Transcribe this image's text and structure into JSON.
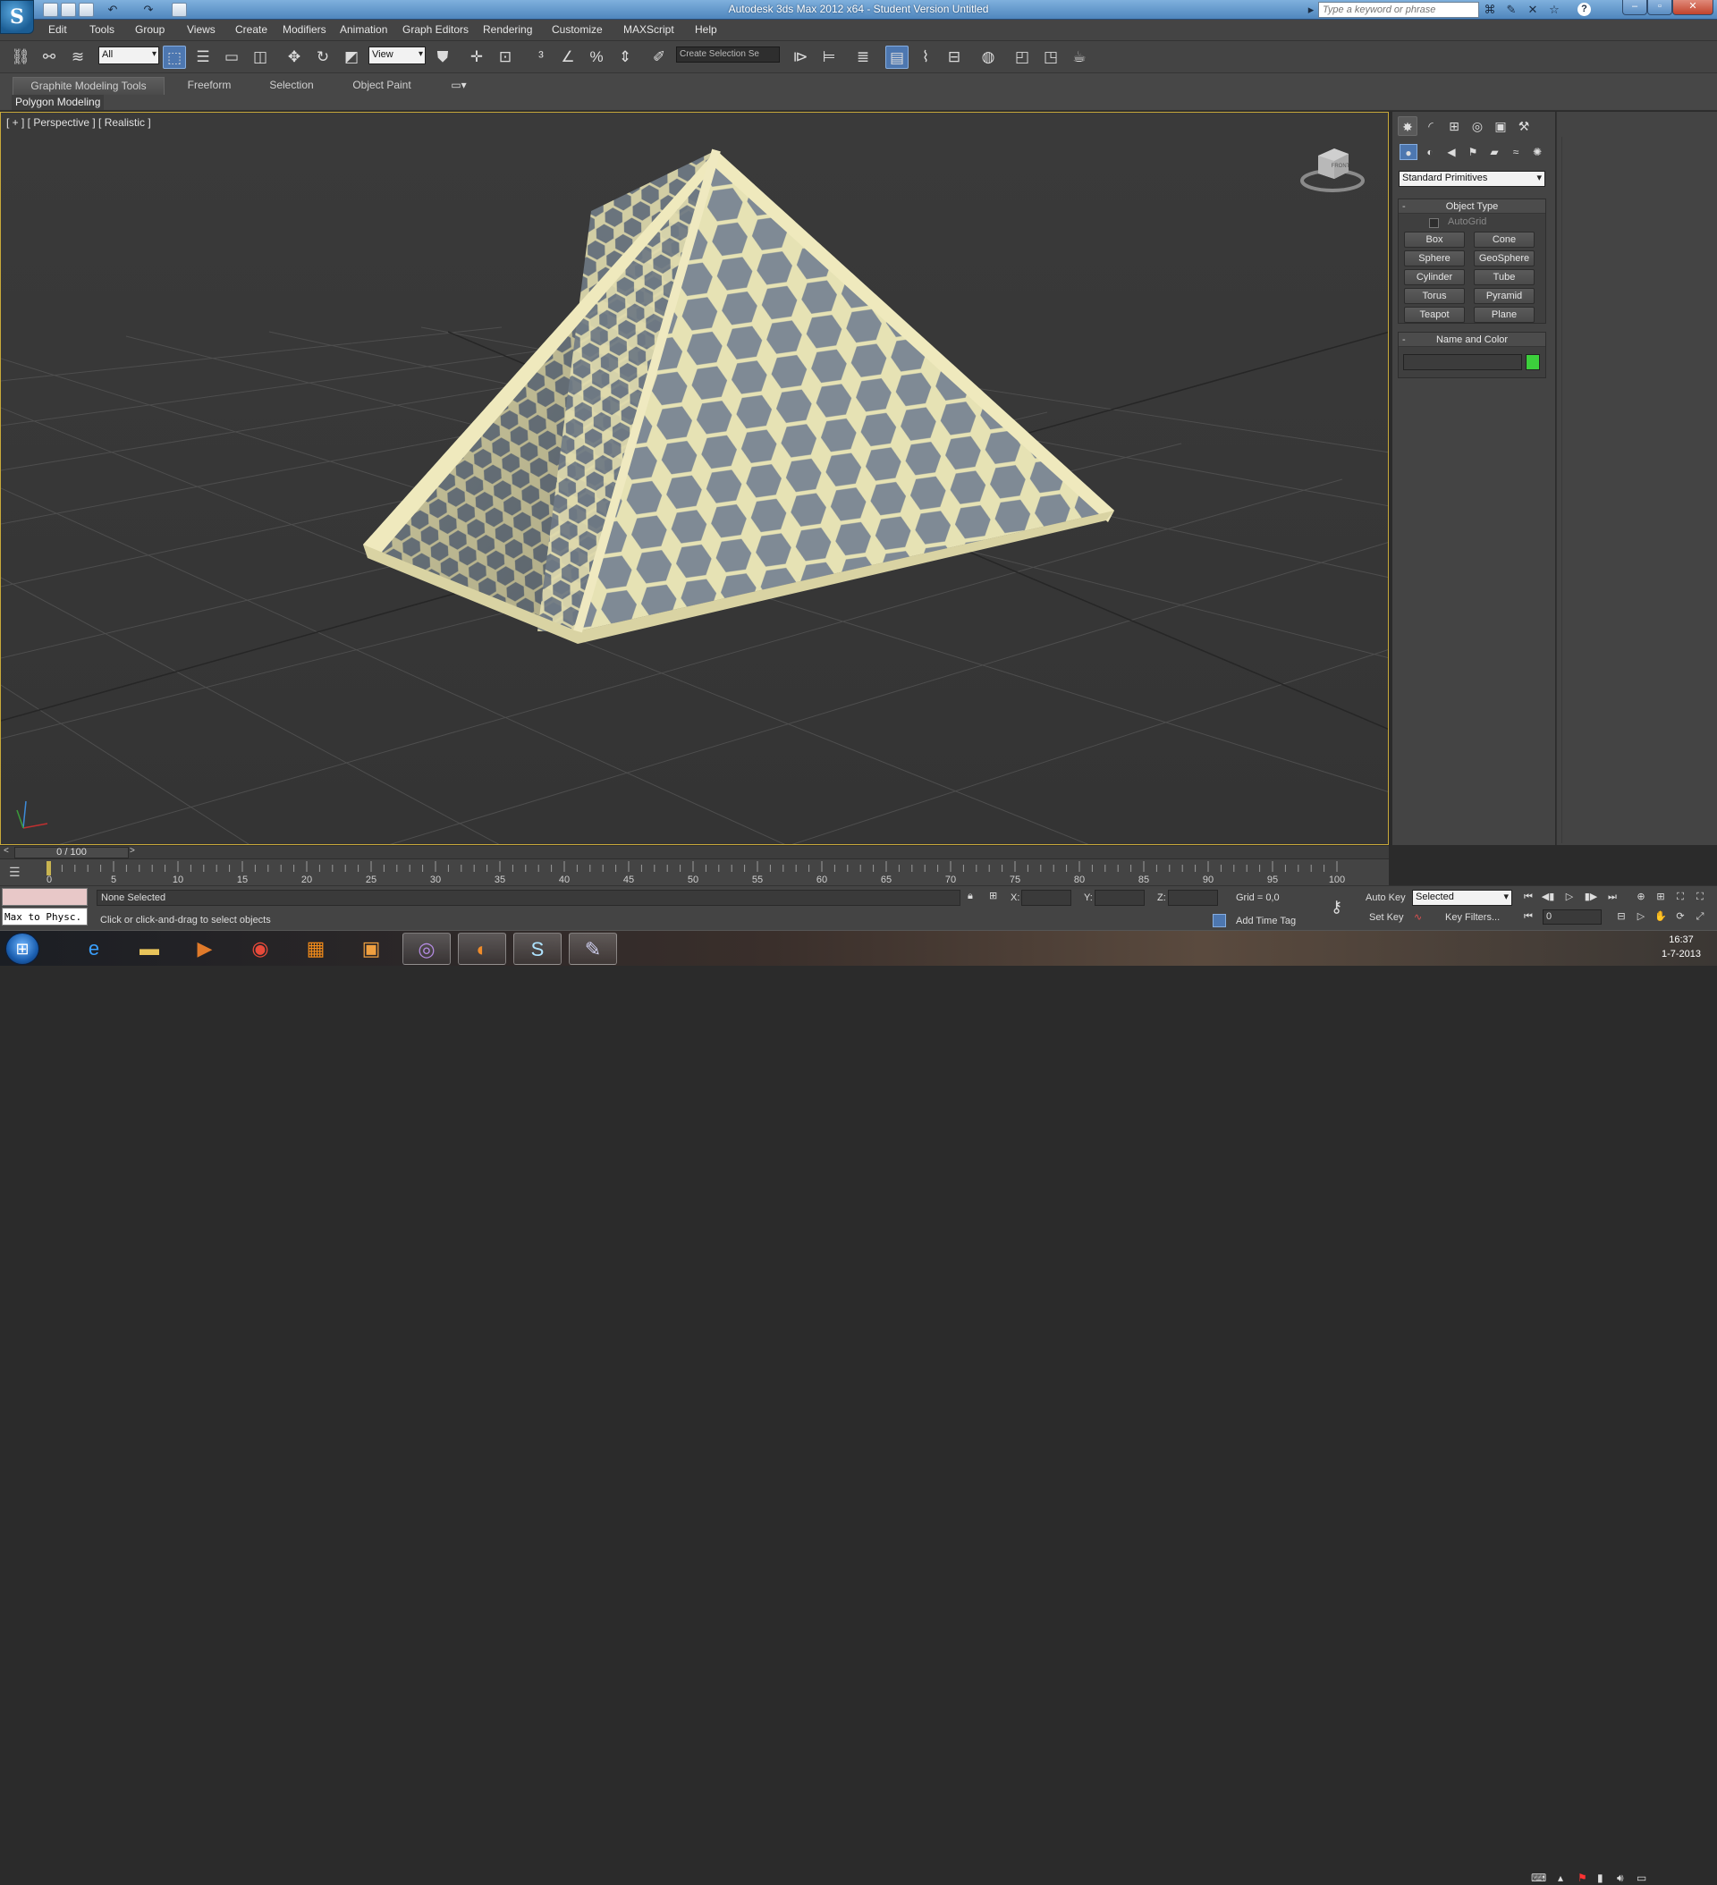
{
  "title": {
    "text": "Autodesk 3ds Max  2012 x64  - Student Version    Untitled",
    "search_placeholder": "Type a keyword or phrase"
  },
  "menu": [
    "Edit",
    "Tools",
    "Group",
    "Views",
    "Create",
    "Modifiers",
    "Animation",
    "Graph Editors",
    "Rendering",
    "Customize",
    "MAXScript",
    "Help"
  ],
  "toolbar": {
    "filter": "All",
    "ref_coord": "View",
    "selection_set": "Create Selection Se"
  },
  "ribbon": {
    "tabs": [
      "Graphite Modeling Tools",
      "Freeform",
      "Selection",
      "Object Paint"
    ],
    "panel": "Polygon Modeling"
  },
  "viewport": {
    "label": "[ + ] [ Perspective ] [ Realistic ]",
    "viewcube": "FRONT"
  },
  "command_panel": {
    "category": "Standard Primitives",
    "object_type": {
      "title": "Object Type",
      "autogrid": "AutoGrid",
      "buttons": [
        "Box",
        "Cone",
        "Sphere",
        "GeoSphere",
        "Cylinder",
        "Tube",
        "Torus",
        "Pyramid",
        "Teapot",
        "Plane"
      ]
    },
    "name_and_color": {
      "title": "Name and Color",
      "color": "#3ccf3c"
    }
  },
  "timeline": {
    "position": "0 / 100",
    "ticks": [
      "0",
      "5",
      "10",
      "15",
      "20",
      "25",
      "30",
      "35",
      "40",
      "45",
      "50",
      "55",
      "60",
      "65",
      "70",
      "75",
      "80",
      "85",
      "90",
      "95",
      "100"
    ]
  },
  "status": {
    "maxscript_text": "Max to Physc.",
    "selection": "None Selected",
    "prompt": "Click or click-and-drag to select objects",
    "x_label": "X:",
    "y_label": "Y:",
    "z_label": "Z:",
    "grid": "Grid = 0,0",
    "add_time_tag": "Add Time Tag",
    "auto_key": "Auto Key",
    "set_key": "Set Key",
    "key_mode": "Selected",
    "key_filters": "Key Filters...",
    "frame": "0"
  },
  "taskbar": {
    "time": "16:37",
    "date": "1-7-2013"
  }
}
